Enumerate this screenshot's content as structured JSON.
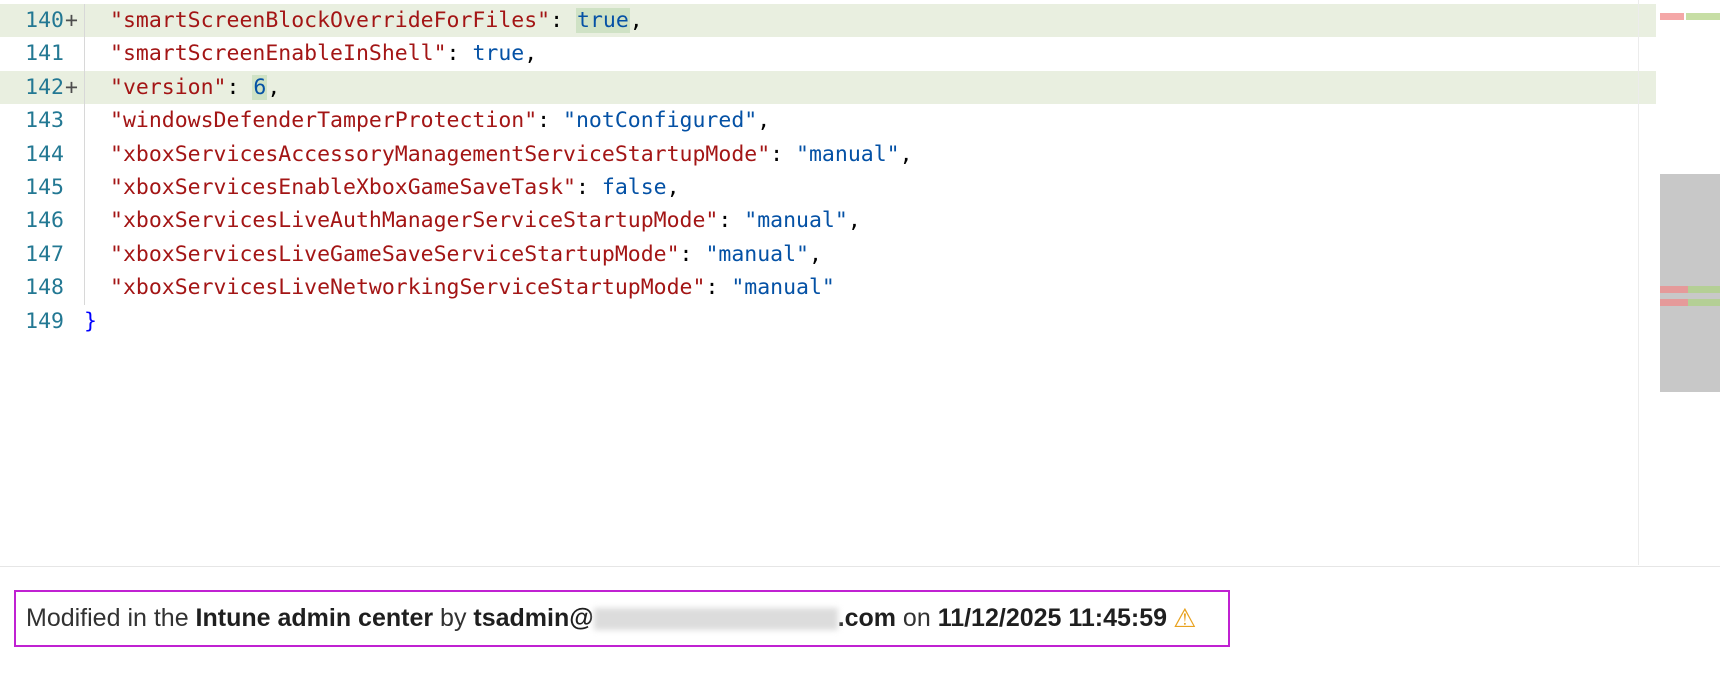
{
  "editor": {
    "lines": [
      {
        "num": "140",
        "marker": "+",
        "added": true,
        "key": "\"smartScreenBlockOverrideForFiles\"",
        "sep": ": ",
        "value": "true",
        "value_highlight": true,
        "trail": ","
      },
      {
        "num": "141",
        "marker": "",
        "added": false,
        "key": "\"smartScreenEnableInShell\"",
        "sep": ": ",
        "value": "true",
        "value_highlight": false,
        "trail": ","
      },
      {
        "num": "142",
        "marker": "+",
        "added": true,
        "key": "\"version\"",
        "sep": ": ",
        "value": "6",
        "value_highlight": true,
        "trail": ","
      },
      {
        "num": "143",
        "marker": "",
        "added": false,
        "key": "\"windowsDefenderTamperProtection\"",
        "sep": ": ",
        "value": "\"notConfigured\"",
        "value_highlight": false,
        "trail": ","
      },
      {
        "num": "144",
        "marker": "",
        "added": false,
        "key": "\"xboxServicesAccessoryManagementServiceStartupMode\"",
        "sep": ": ",
        "value": "\"manual\"",
        "value_highlight": false,
        "trail": ","
      },
      {
        "num": "145",
        "marker": "",
        "added": false,
        "key": "\"xboxServicesEnableXboxGameSaveTask\"",
        "sep": ": ",
        "value": "false",
        "value_highlight": false,
        "trail": ","
      },
      {
        "num": "146",
        "marker": "",
        "added": false,
        "key": "\"xboxServicesLiveAuthManagerServiceStartupMode\"",
        "sep": ": ",
        "value": "\"manual\"",
        "value_highlight": false,
        "trail": ","
      },
      {
        "num": "147",
        "marker": "",
        "added": false,
        "key": "\"xboxServicesLiveGameSaveServiceStartupMode\"",
        "sep": ": ",
        "value": "\"manual\"",
        "value_highlight": false,
        "trail": ","
      },
      {
        "num": "148",
        "marker": "",
        "added": false,
        "key": "\"xboxServicesLiveNetworkingServiceStartupMode\"",
        "sep": ": ",
        "value": "\"manual\"",
        "value_highlight": false,
        "trail": ""
      },
      {
        "num": "149",
        "marker": "",
        "added": false,
        "closing": "}"
      }
    ]
  },
  "colors": {
    "added_line_bg": "#e9efe0",
    "key": "#a31515",
    "value": "#0451a5",
    "line_number": "#237893",
    "footer_border": "#c021d2",
    "warning": "#e8a21f"
  },
  "footer": {
    "prefix": "Modified in the ",
    "app": "Intune admin center",
    "by": " by ",
    "user_start": "tsadmin@",
    "user_end": ".com",
    "on": " on ",
    "timestamp": "11/12/2025 11:45:59",
    "warning_icon": "warning-triangle-icon",
    "warning_glyph": "⚠"
  }
}
